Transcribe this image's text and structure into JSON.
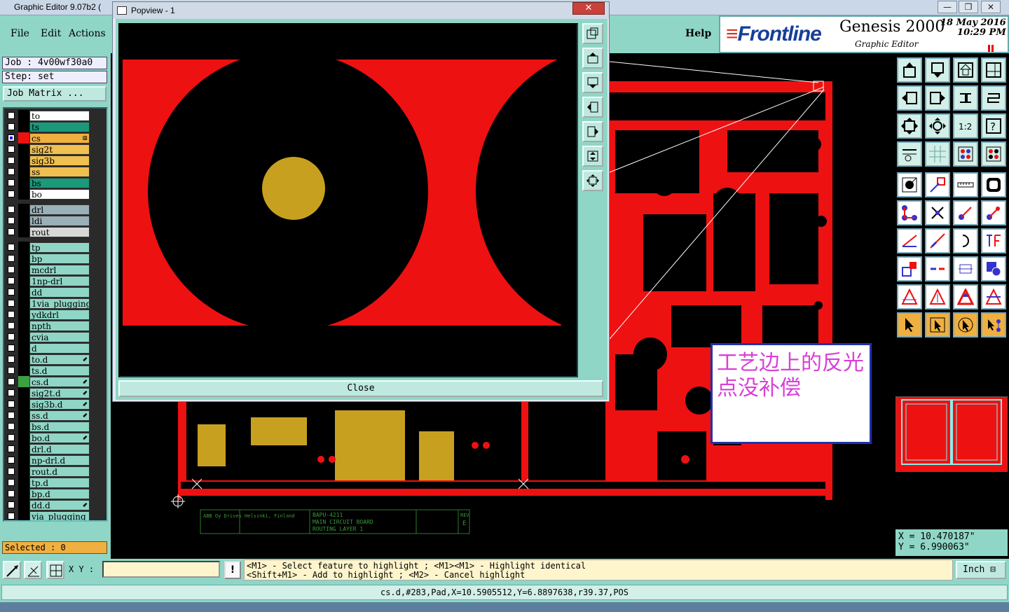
{
  "window": {
    "title": "Graphic Editor 9.07b2 (",
    "controls": [
      "—",
      "❐",
      "✕"
    ]
  },
  "menu": {
    "file": "File",
    "edit": "Edit",
    "actions": "Actions",
    "help": "Help"
  },
  "brand": {
    "logo": "Frontline",
    "product": "Genesis 2000",
    "subtitle": "Graphic Editor",
    "date": "18 May 2016",
    "time": "10:29 PM"
  },
  "left_panel": {
    "job": "Job : 4v00wf30a0",
    "step": "Step: set",
    "job_matrix": "Job Matrix ...",
    "layers": [
      {
        "name": "to",
        "color": "#ffffff",
        "swatch": "#000000",
        "checked": false,
        "mark": ""
      },
      {
        "name": "ts",
        "color": "#1a9a7a",
        "swatch": "#000000",
        "checked": false,
        "mark": ""
      },
      {
        "name": "cs",
        "color": "#f0b040",
        "swatch": "#ee1111",
        "checked": true,
        "mark": "⊞"
      },
      {
        "name": "sig2t",
        "color": "#f0c050",
        "swatch": "#000000",
        "checked": false,
        "mark": ""
      },
      {
        "name": "sig3b",
        "color": "#f0c050",
        "swatch": "#000000",
        "checked": false,
        "mark": ""
      },
      {
        "name": "ss",
        "color": "#f0c050",
        "swatch": "#000000",
        "checked": false,
        "mark": ""
      },
      {
        "name": "bs",
        "color": "#1a9a7a",
        "swatch": "#000000",
        "checked": false,
        "mark": ""
      },
      {
        "name": "bo",
        "color": "#ffffff",
        "swatch": "#000000",
        "checked": false,
        "mark": ""
      },
      {
        "name": "drl",
        "color": "#9ab0b8",
        "swatch": "#000000",
        "checked": false,
        "mark": ""
      },
      {
        "name": "ldi",
        "color": "#9ab0b8",
        "swatch": "#000000",
        "checked": false,
        "mark": ""
      },
      {
        "name": "rout",
        "color": "#d8d8d8",
        "swatch": "#000000",
        "checked": false,
        "mark": ""
      },
      {
        "name": "tp",
        "color": "#8fd6c6",
        "swatch": "#000000",
        "checked": false,
        "mark": ""
      },
      {
        "name": "bp",
        "color": "#8fd6c6",
        "swatch": "#000000",
        "checked": false,
        "mark": ""
      },
      {
        "name": "mcdrl",
        "color": "#8fd6c6",
        "swatch": "#000000",
        "checked": false,
        "mark": ""
      },
      {
        "name": "1np-drl",
        "color": "#8fd6c6",
        "swatch": "#000000",
        "checked": false,
        "mark": ""
      },
      {
        "name": "dd",
        "color": "#8fd6c6",
        "swatch": "#000000",
        "checked": false,
        "mark": ""
      },
      {
        "name": "1via_plugging",
        "color": "#8fd6c6",
        "swatch": "#000000",
        "checked": false,
        "mark": ""
      },
      {
        "name": "ydkdrl",
        "color": "#8fd6c6",
        "swatch": "#000000",
        "checked": false,
        "mark": ""
      },
      {
        "name": "npth",
        "color": "#8fd6c6",
        "swatch": "#000000",
        "checked": false,
        "mark": ""
      },
      {
        "name": "cvia",
        "color": "#8fd6c6",
        "swatch": "#000000",
        "checked": false,
        "mark": ""
      },
      {
        "name": "d",
        "color": "#8fd6c6",
        "swatch": "#000000",
        "checked": false,
        "mark": ""
      },
      {
        "name": "to.d",
        "color": "#8fd6c6",
        "swatch": "#000000",
        "checked": false,
        "mark": "⬋"
      },
      {
        "name": "ts.d",
        "color": "#8fd6c6",
        "swatch": "#000000",
        "checked": false,
        "mark": ""
      },
      {
        "name": "cs.d",
        "color": "#8fd6c6",
        "swatch": "#3aa040",
        "checked": false,
        "mark": "⬋"
      },
      {
        "name": "sig2t.d",
        "color": "#8fd6c6",
        "swatch": "#000000",
        "checked": false,
        "mark": "⬋"
      },
      {
        "name": "sig3b.d",
        "color": "#8fd6c6",
        "swatch": "#000000",
        "checked": false,
        "mark": "⬋"
      },
      {
        "name": "ss.d",
        "color": "#8fd6c6",
        "swatch": "#000000",
        "checked": false,
        "mark": "⬋"
      },
      {
        "name": "bs.d",
        "color": "#8fd6c6",
        "swatch": "#000000",
        "checked": false,
        "mark": ""
      },
      {
        "name": "bo.d",
        "color": "#8fd6c6",
        "swatch": "#000000",
        "checked": false,
        "mark": "⬋"
      },
      {
        "name": "drl.d",
        "color": "#8fd6c6",
        "swatch": "#000000",
        "checked": false,
        "mark": ""
      },
      {
        "name": "np-drl.d",
        "color": "#8fd6c6",
        "swatch": "#000000",
        "checked": false,
        "mark": ""
      },
      {
        "name": "rout.d",
        "color": "#8fd6c6",
        "swatch": "#000000",
        "checked": false,
        "mark": ""
      },
      {
        "name": "tp.d",
        "color": "#8fd6c6",
        "swatch": "#000000",
        "checked": false,
        "mark": ""
      },
      {
        "name": "bp.d",
        "color": "#8fd6c6",
        "swatch": "#000000",
        "checked": false,
        "mark": ""
      },
      {
        "name": "dd.d",
        "color": "#8fd6c6",
        "swatch": "#000000",
        "checked": false,
        "mark": "⬋"
      },
      {
        "name": "via_plugging",
        "color": "#8fd6c6",
        "swatch": "#000000",
        "checked": false,
        "mark": ""
      }
    ],
    "selected": "Selected : 0"
  },
  "popview": {
    "title": "Popview - 1",
    "close_x": "✕",
    "close_button": "Close"
  },
  "annotation": {
    "text": "工艺边上的反光点没补偿"
  },
  "title_block": {
    "company": "ABB Oy Drives Helsinki, Finland",
    "part": "BAPU-4211",
    "desc1": "MAIN CIRCUIT BOARD",
    "desc2": "ROUTING LAYER 1",
    "rev_label": "REV",
    "rev": "E"
  },
  "coords": {
    "x": "X = 10.470187\"",
    "y": "Y = 6.990063\""
  },
  "bottom": {
    "xy_label": "X Y :",
    "xy_value": "",
    "warn": "!",
    "hint_line1": "<M1> - Select feature to highlight ; <M1><M1> - Highlight identical",
    "hint_line2": "<Shift+M1> - Add to highlight ; <M2> - Cancel highlight",
    "unit": "Inch",
    "status": "cs.d,#283,Pad,X=10.5905512,Y=6.8897638,r39.37,POS"
  },
  "colors": {
    "panel": "#8fd6c6",
    "copper": "#ee1111",
    "gold": "#c8a020"
  }
}
